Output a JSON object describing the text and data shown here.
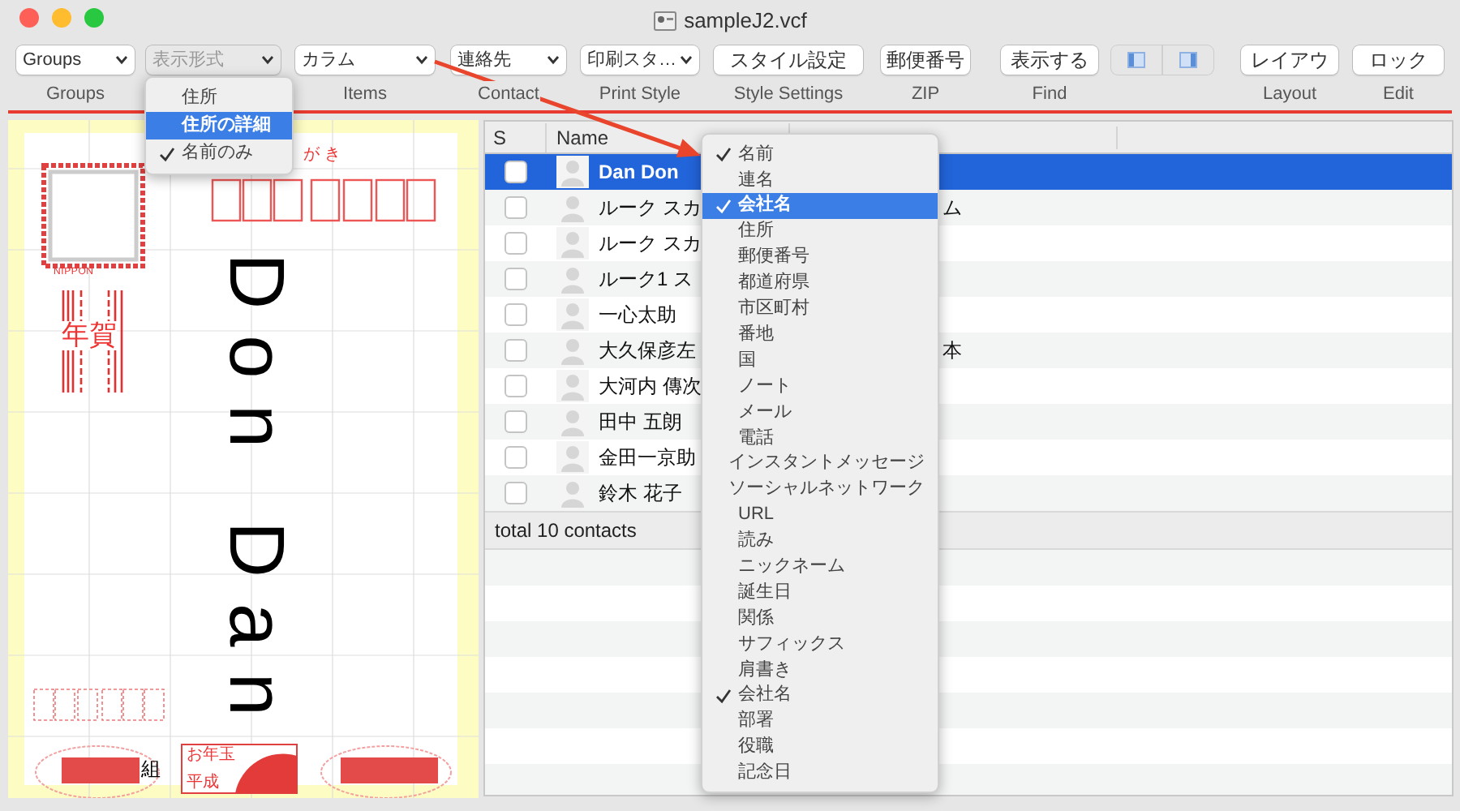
{
  "window": {
    "title": "sampleJ2.vcf"
  },
  "toolbar": [
    {
      "kind": "select",
      "value": "Groups",
      "label": "Groups",
      "disabled": false
    },
    {
      "kind": "select",
      "value": "表示形式",
      "disabled": true
    },
    {
      "kind": "select",
      "value": "カラム",
      "label": "Items",
      "disabled": false
    },
    {
      "kind": "select",
      "value": "連絡先",
      "label": "Contact",
      "disabled": false
    },
    {
      "kind": "select",
      "value": "印刷スタ…",
      "label": "Print Style",
      "disabled": false
    },
    {
      "kind": "button",
      "value": "スタイル設定",
      "label": "Style Settings"
    },
    {
      "kind": "button",
      "value": "郵便番号",
      "label": "ZIP"
    },
    {
      "kind": "button",
      "value": "表示する",
      "label": "Find"
    },
    {
      "kind": "segmented"
    },
    {
      "kind": "button",
      "value": "レイアウ",
      "label": "Layout"
    },
    {
      "kind": "button",
      "value": "ロック",
      "label": "Edit"
    }
  ],
  "display_menu": {
    "items": [
      {
        "label": "住所",
        "selected": false,
        "checked": false
      },
      {
        "label": "住所の詳細",
        "selected": true,
        "checked": false
      },
      {
        "label": "名前のみ",
        "selected": false,
        "checked": true
      }
    ]
  },
  "postcard": {
    "kana": "が き",
    "stamp_text": "NIPPON",
    "greeting": "年賀",
    "name": "Don Dan",
    "group_mark": "組",
    "lottery": "お年玉",
    "era": "平成"
  },
  "table": {
    "columns": [
      "S",
      "Name"
    ],
    "rows": [
      {
        "name": "Dan Don",
        "selected": true,
        "checked": false
      },
      {
        "name": "ルーク スカ",
        "column_3": "ム",
        "selected": false,
        "checked": false
      },
      {
        "name": "ルーク スカ",
        "selected": false,
        "checked": false
      },
      {
        "name": "ルーク1 ス",
        "selected": false,
        "checked": false
      },
      {
        "name": "一心太助",
        "selected": false,
        "checked": false
      },
      {
        "name": "大久保彦左",
        "column_3": "本",
        "selected": false,
        "checked": false
      },
      {
        "name": "大河内 傳次",
        "selected": false,
        "checked": false
      },
      {
        "name": "田中 五朗",
        "selected": false,
        "checked": false
      },
      {
        "name": "金田一京助",
        "selected": false,
        "checked": false
      },
      {
        "name": "鈴木 花子",
        "selected": false,
        "checked": false
      }
    ],
    "footer": "total 10 contacts"
  },
  "column_menu": {
    "items": [
      {
        "label": "名前",
        "selected": false,
        "checked": true
      },
      {
        "label": "連名",
        "selected": false,
        "checked": false
      },
      {
        "label": "会社名",
        "selected": true,
        "checked": true
      },
      {
        "label": "住所",
        "selected": false,
        "checked": false
      },
      {
        "label": "郵便番号",
        "selected": false,
        "checked": false
      },
      {
        "label": "都道府県",
        "selected": false,
        "checked": false
      },
      {
        "label": "市区町村",
        "selected": false,
        "checked": false
      },
      {
        "label": "番地",
        "selected": false,
        "checked": false
      },
      {
        "label": "国",
        "selected": false,
        "checked": false
      },
      {
        "label": "ノート",
        "selected": false,
        "checked": false
      },
      {
        "label": "メール",
        "selected": false,
        "checked": false
      },
      {
        "label": "電話",
        "selected": false,
        "checked": false
      },
      {
        "label": "インスタントメッセージ",
        "selected": false,
        "checked": false
      },
      {
        "label": "ソーシャルネットワーク",
        "selected": false,
        "checked": false
      },
      {
        "label": "URL",
        "selected": false,
        "checked": false
      },
      {
        "label": "読み",
        "selected": false,
        "checked": false
      },
      {
        "label": "ニックネーム",
        "selected": false,
        "checked": false
      },
      {
        "label": "誕生日",
        "selected": false,
        "checked": false
      },
      {
        "label": "関係",
        "selected": false,
        "checked": false
      },
      {
        "label": "サフィックス",
        "selected": false,
        "checked": false
      },
      {
        "label": "肩書き",
        "selected": false,
        "checked": false
      },
      {
        "label": "会社名",
        "selected": false,
        "checked": true
      },
      {
        "label": "部署",
        "selected": false,
        "checked": false
      },
      {
        "label": "役職",
        "selected": false,
        "checked": false
      },
      {
        "label": "記念日",
        "selected": false,
        "checked": false
      }
    ]
  }
}
